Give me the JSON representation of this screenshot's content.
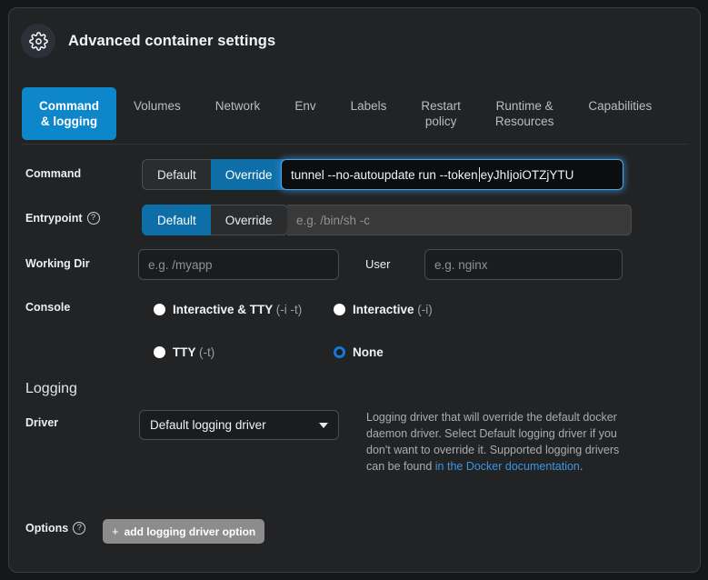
{
  "header": {
    "icon": "gear-icon",
    "title": "Advanced container settings"
  },
  "tabs": [
    {
      "label": "Command\n& logging",
      "active": true
    },
    {
      "label": "Volumes",
      "active": false
    },
    {
      "label": "Network",
      "active": false
    },
    {
      "label": "Env",
      "active": false
    },
    {
      "label": "Labels",
      "active": false
    },
    {
      "label": "Restart\npolicy",
      "active": false
    },
    {
      "label": "Runtime &\nResources",
      "active": false
    },
    {
      "label": "Capabilities",
      "active": false
    }
  ],
  "command_row": {
    "label": "Command",
    "toggle": {
      "default_label": "Default",
      "override_label": "Override",
      "selected": "Override"
    },
    "value_before_caret": "tunnel --no-autoupdate run --token ",
    "value_after_caret": "eyJhIjoiOTZjYTU"
  },
  "entrypoint_row": {
    "label": "Entrypoint",
    "help_icon": "question-mark-icon",
    "toggle": {
      "default_label": "Default",
      "override_label": "Override",
      "selected": "Default"
    },
    "placeholder": "e.g. /bin/sh -c"
  },
  "working_dir_row": {
    "label": "Working Dir",
    "placeholder": "e.g. /myapp",
    "user_label": "User",
    "user_placeholder": "e.g. nginx"
  },
  "console_row": {
    "label": "Console",
    "options": [
      {
        "text": "Interactive & TTY ",
        "flag": "(-i -t)",
        "selected": false
      },
      {
        "text": "Interactive ",
        "flag": "(-i)",
        "selected": false
      },
      {
        "text": "TTY ",
        "flag": "(-t)",
        "selected": false
      },
      {
        "text": "None",
        "flag": "",
        "selected": true
      }
    ]
  },
  "logging": {
    "section_title": "Logging",
    "driver_label": "Driver",
    "driver_value": "Default logging driver",
    "help_text_1": "Logging driver that will override the default docker daemon driver. Select Default logging driver if you don't want to override it. Supported logging drivers can be found ",
    "help_link": "in the Docker documentation",
    "help_text_2": ".",
    "options_label": "Options",
    "options_help_icon": "question-mark-icon",
    "add_option_label": "add logging driver option",
    "add_option_plus": "+"
  },
  "colors": {
    "accent": "#0e86ca",
    "accent_dark": "#0e6fa8",
    "page_bg": "#161718",
    "card_bg": "#222324",
    "link": "#3d95e0",
    "radio_selected": "#1478d4"
  }
}
